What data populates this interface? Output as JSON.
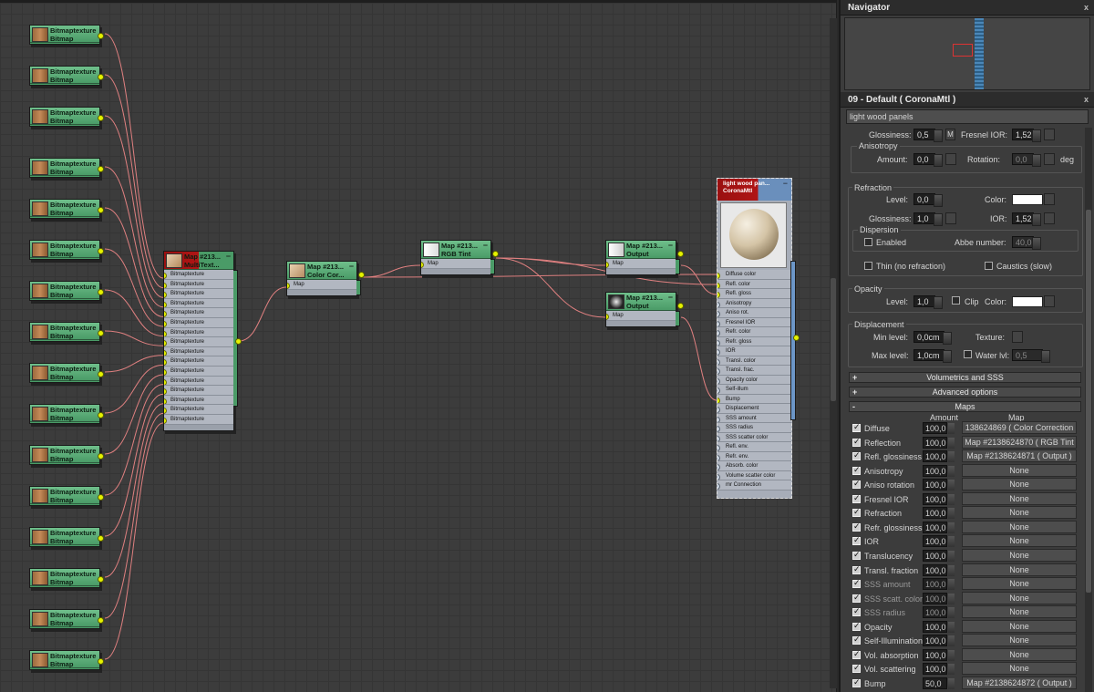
{
  "navigator": {
    "title": "Navigator",
    "close": "x"
  },
  "material": {
    "title": "09 - Default  ( CoronaMtl )",
    "close": "x",
    "name": "light wood panels"
  },
  "reflection": {
    "glossiness_label": "Glossiness:",
    "glossiness": "0,5",
    "m": "M",
    "fresnel_label": "Fresnel IOR:",
    "fresnel": "1,52",
    "aniso_group": "Anisotropy",
    "amount_label": "Amount:",
    "amount": "0,0",
    "rotation_label": "Rotation:",
    "rotation": "0,0",
    "deg": "deg"
  },
  "refraction": {
    "group": "Refraction",
    "level_label": "Level:",
    "level": "0,0",
    "color_label": "Color:",
    "gloss_label": "Glossiness:",
    "gloss": "1,0",
    "ior_label": "IOR:",
    "ior": "1,52",
    "dispersion": "Dispersion",
    "enabled": "Enabled",
    "abbe_label": "Abbe number:",
    "abbe": "40,0",
    "thin": "Thin (no refraction)",
    "caustics": "Caustics (slow)"
  },
  "opacity": {
    "group": "Opacity",
    "level_label": "Level:",
    "level": "1,0",
    "clip": "Clip",
    "color_label": "Color:"
  },
  "displacement": {
    "group": "Displacement",
    "min_label": "Min level:",
    "min": "0,0cm",
    "texture_label": "Texture:",
    "max_label": "Max level:",
    "max": "1,0cm",
    "water_label": "Water lvl:",
    "water": "0,5"
  },
  "rollouts": {
    "vol": "Volumetrics and SSS",
    "adv": "Advanced options",
    "maps": "Maps",
    "plus": "+",
    "minus": "-"
  },
  "maps_header": {
    "amount": "Amount",
    "map": "Map"
  },
  "maps": [
    {
      "label": "Diffuse",
      "amount": "100,0",
      "map": "138624869  ( Color Correction )",
      "checked": true
    },
    {
      "label": "Reflection",
      "amount": "100,0",
      "map": "Map #2138624870  ( RGB Tint )",
      "checked": true
    },
    {
      "label": "Refl. glossiness",
      "amount": "100,0",
      "map": "Map #2138624871  ( Output )",
      "checked": true
    },
    {
      "label": "Anisotropy",
      "amount": "100,0",
      "map": "None",
      "checked": true
    },
    {
      "label": "Aniso rotation",
      "amount": "100,0",
      "map": "None",
      "checked": true
    },
    {
      "label": "Fresnel IOR",
      "amount": "100,0",
      "map": "None",
      "checked": true
    },
    {
      "label": "Refraction",
      "amount": "100,0",
      "map": "None",
      "checked": true
    },
    {
      "label": "Refr. glossiness",
      "amount": "100,0",
      "map": "None",
      "checked": true
    },
    {
      "label": "IOR",
      "amount": "100,0",
      "map": "None",
      "checked": true
    },
    {
      "label": "Translucency",
      "amount": "100,0",
      "map": "None",
      "checked": true
    },
    {
      "label": "Transl. fraction",
      "amount": "100,0",
      "map": "None",
      "checked": true
    },
    {
      "label": "SSS amount",
      "amount": "100,0",
      "map": "None",
      "checked": true,
      "disabled": true
    },
    {
      "label": "SSS scatt. color",
      "amount": "100,0",
      "map": "None",
      "checked": true,
      "disabled": true
    },
    {
      "label": "SSS radius",
      "amount": "100,0",
      "map": "None",
      "checked": true,
      "disabled": true
    },
    {
      "label": "Opacity",
      "amount": "100,0",
      "map": "None",
      "checked": true
    },
    {
      "label": "Self-Illumination",
      "amount": "100,0",
      "map": "None",
      "checked": true
    },
    {
      "label": "Vol. absorption",
      "amount": "100,0",
      "map": "None",
      "checked": true
    },
    {
      "label": "Vol. scattering",
      "amount": "100,0",
      "map": "None",
      "checked": true
    },
    {
      "label": "Bump",
      "amount": "50,0",
      "map": "Map #2138624872  ( Output )",
      "checked": true
    }
  ],
  "bitmap_node": {
    "t1": "Bitmaptexture",
    "t2": "Bitmap"
  },
  "multitex": {
    "t1": "Map #213...",
    "t2": "MultiText...",
    "slot": "Bitmaptexture",
    "mini": "−"
  },
  "cc": {
    "t1": "Map #213...",
    "t2": "Color Cor...",
    "slot": "Map",
    "mini": "−"
  },
  "tint": {
    "t1": "Map #213...",
    "t2": "RGB Tint",
    "slot": "Map",
    "mini": "−"
  },
  "out1": {
    "t1": "Map #213...",
    "t2": "Output",
    "slot": "Map",
    "mini": "−"
  },
  "out2": {
    "t1": "Map #213...",
    "t2": "Output",
    "slot": "Map",
    "mini": "−"
  },
  "main_node": {
    "t1": "light wood pan...",
    "t2": "CoronaMtl",
    "mini": "−",
    "slots": [
      "Diffuse color",
      "Refl. color",
      "Refl. gloss",
      "Anisotropy",
      "Aniso rot.",
      "Fresnel IOR",
      "Refr. color",
      "Refr. gloss",
      "IOR",
      "Transl. color",
      "Transl. frac.",
      "Opacity color",
      "Self-illum",
      "Bump",
      "Displacement",
      "SSS amount",
      "SSS radius",
      "SSS scatter color",
      "Refl. env.",
      "Refr. env.",
      "Absorb. color",
      "Volume scatter color",
      "mr Connection"
    ],
    "connected": [
      0,
      1,
      2,
      13
    ]
  }
}
